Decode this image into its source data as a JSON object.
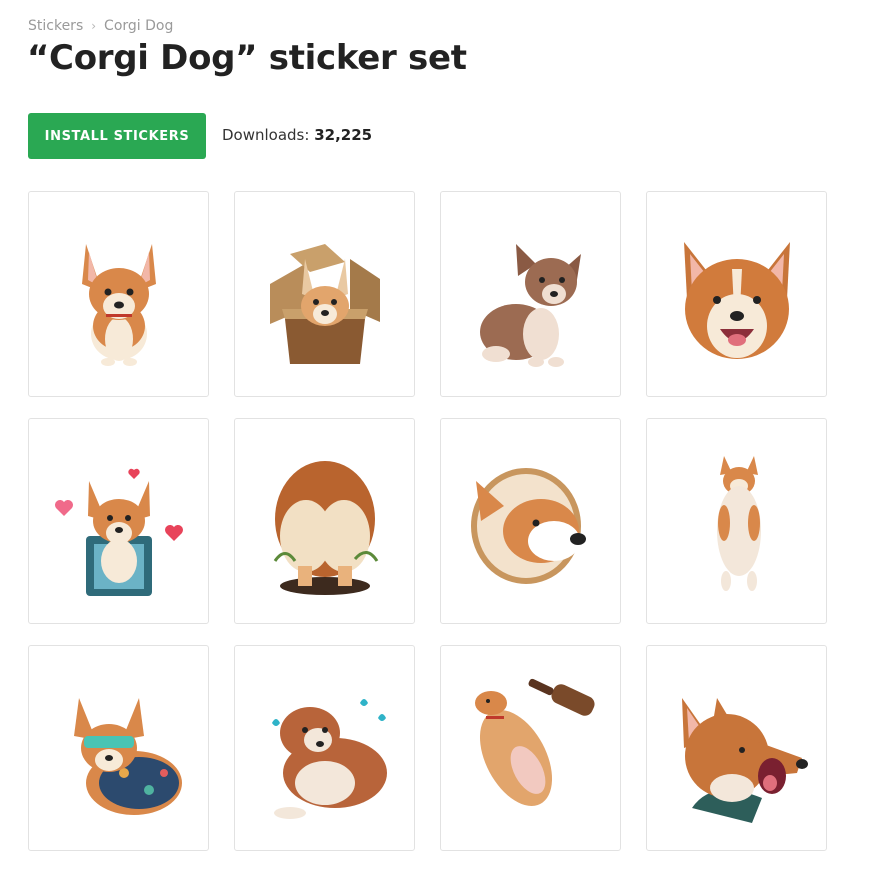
{
  "breadcrumb": {
    "root": "Stickers",
    "current": "Corgi Dog"
  },
  "title": "“Corgi Dog” sticker set",
  "install_label": "INSTALL STICKERS",
  "downloads": {
    "label": "Downloads:",
    "count": "32,225"
  },
  "colors": {
    "accent": "#2aa853",
    "fur": "#d9884a",
    "fur_dark": "#b86a32",
    "cream": "#f7ead8"
  },
  "stickers": [
    {
      "name": "corgi-sitting-sticker"
    },
    {
      "name": "corgi-in-box-sticker"
    },
    {
      "name": "corgi-puppy-brown-sticker"
    },
    {
      "name": "corgi-smiling-face-sticker"
    },
    {
      "name": "corgi-hearts-sticker"
    },
    {
      "name": "corgi-butt-sticker"
    },
    {
      "name": "corgi-bread-sticker"
    },
    {
      "name": "corgi-lying-back-sticker"
    },
    {
      "name": "corgi-sunglasses-sticker"
    },
    {
      "name": "corgi-crying-sticker"
    },
    {
      "name": "corgi-bottle-sticker"
    },
    {
      "name": "corgi-yawning-sticker"
    }
  ]
}
